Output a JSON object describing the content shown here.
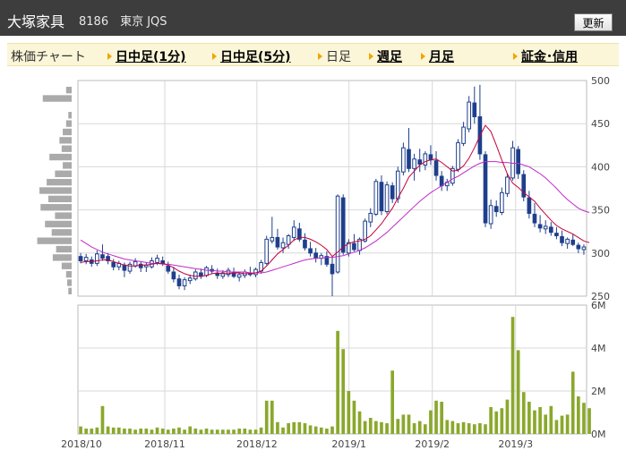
{
  "header": {
    "company": "大塚家具",
    "meta": "8186　東京 JQS",
    "refresh_label": "更新"
  },
  "tabs": [
    {
      "label": "株価チャート",
      "link": false,
      "arrow": false
    },
    {
      "label": "日中足(1分)",
      "link": true,
      "arrow": true
    },
    {
      "label": "日中足(5分)",
      "link": true,
      "arrow": true
    },
    {
      "label": "日足",
      "link": false,
      "arrow": true
    },
    {
      "label": "週足",
      "link": true,
      "arrow": true
    },
    {
      "label": "月足",
      "link": true,
      "arrow": true
    },
    {
      "label": "証金･信用",
      "link": true,
      "arrow": true
    }
  ],
  "chart_data": [
    {
      "type": "candlestick",
      "y_ticks": [
        "500",
        "450",
        "400",
        "350",
        "300",
        "250"
      ],
      "ylim": [
        250,
        500
      ],
      "x_ticks": [
        "2018/10",
        "2018/11",
        "2018/12",
        "2019/1",
        "2019/2",
        "2019/3"
      ],
      "candles": [
        [
          296,
          300,
          288,
          291
        ],
        [
          291,
          299,
          287,
          295
        ],
        [
          292,
          296,
          284,
          288
        ],
        [
          288,
          303,
          285,
          299
        ],
        [
          298,
          310,
          291,
          294
        ],
        [
          296,
          300,
          287,
          291
        ],
        [
          289,
          293,
          280,
          284
        ],
        [
          284,
          291,
          280,
          288
        ],
        [
          286,
          289,
          272,
          280
        ],
        [
          279,
          290,
          276,
          287
        ],
        [
          285,
          294,
          283,
          290
        ],
        [
          287,
          290,
          278,
          283
        ],
        [
          284,
          289,
          278,
          286
        ],
        [
          284,
          295,
          282,
          291
        ],
        [
          289,
          298,
          286,
          294
        ],
        [
          291,
          296,
          285,
          288
        ],
        [
          285,
          290,
          276,
          279
        ],
        [
          278,
          284,
          266,
          270
        ],
        [
          270,
          275,
          258,
          262
        ],
        [
          262,
          272,
          257,
          269
        ],
        [
          268,
          275,
          264,
          271
        ],
        [
          270,
          281,
          268,
          278
        ],
        [
          277,
          282,
          270,
          273
        ],
        [
          274,
          285,
          272,
          283
        ],
        [
          281,
          286,
          276,
          279
        ],
        [
          276,
          282,
          270,
          274
        ],
        [
          273,
          280,
          270,
          277
        ],
        [
          275,
          283,
          272,
          280
        ],
        [
          278,
          283,
          271,
          273
        ],
        [
          272,
          278,
          267,
          275
        ],
        [
          274,
          281,
          271,
          278
        ],
        [
          277,
          284,
          273,
          275
        ],
        [
          275,
          283,
          272,
          281
        ],
        [
          279,
          292,
          276,
          289
        ],
        [
          288,
          320,
          286,
          316
        ],
        [
          314,
          342,
          311,
          318
        ],
        [
          318,
          328,
          304,
          307
        ],
        [
          306,
          318,
          300,
          312
        ],
        [
          310,
          322,
          305,
          320
        ],
        [
          318,
          338,
          314,
          330
        ],
        [
          328,
          335,
          313,
          316
        ],
        [
          315,
          323,
          303,
          306
        ],
        [
          305,
          313,
          296,
          300
        ],
        [
          300,
          306,
          289,
          294
        ],
        [
          294,
          300,
          286,
          297
        ],
        [
          296,
          302,
          284,
          287
        ],
        [
          287,
          295,
          250,
          276
        ],
        [
          278,
          368,
          276,
          366
        ],
        [
          364,
          368,
          298,
          301
        ],
        [
          300,
          316,
          296,
          312
        ],
        [
          311,
          322,
          302,
          304
        ],
        [
          303,
          318,
          298,
          316
        ],
        [
          314,
          340,
          312,
          337
        ],
        [
          336,
          352,
          330,
          346
        ],
        [
          345,
          386,
          343,
          383
        ],
        [
          382,
          390,
          344,
          349
        ],
        [
          348,
          383,
          345,
          379
        ],
        [
          378,
          382,
          358,
          363
        ],
        [
          363,
          400,
          358,
          395
        ],
        [
          394,
          428,
          390,
          422
        ],
        [
          420,
          445,
          394,
          398
        ],
        [
          398,
          415,
          384,
          409
        ],
        [
          408,
          421,
          394,
          403
        ],
        [
          402,
          418,
          396,
          415
        ],
        [
          414,
          425,
          402,
          408
        ],
        [
          407,
          418,
          384,
          390
        ],
        [
          389,
          395,
          372,
          378
        ],
        [
          378,
          386,
          372,
          382
        ],
        [
          381,
          401,
          378,
          398
        ],
        [
          397,
          432,
          394,
          428
        ],
        [
          427,
          452,
          424,
          446
        ],
        [
          444,
          482,
          440,
          475
        ],
        [
          474,
          493,
          450,
          458
        ],
        [
          458,
          495,
          408,
          415
        ],
        [
          414,
          418,
          330,
          335
        ],
        [
          334,
          362,
          328,
          355
        ],
        [
          354,
          361,
          342,
          348
        ],
        [
          347,
          376,
          344,
          370
        ],
        [
          369,
          392,
          365,
          388
        ],
        [
          387,
          430,
          384,
          422
        ],
        [
          420,
          424,
          386,
          392
        ],
        [
          391,
          396,
          360,
          365
        ],
        [
          364,
          372,
          340,
          346
        ],
        [
          345,
          358,
          330,
          335
        ],
        [
          333,
          344,
          324,
          329
        ],
        [
          328,
          338,
          322,
          331
        ],
        [
          330,
          336,
          320,
          324
        ],
        [
          323,
          330,
          316,
          320
        ],
        [
          319,
          326,
          308,
          312
        ],
        [
          311,
          318,
          305,
          316
        ],
        [
          315,
          322,
          308,
          310
        ],
        [
          309,
          312,
          300,
          305
        ],
        [
          304,
          310,
          298,
          307
        ]
      ],
      "ma_short": [
        289,
        290,
        290,
        291,
        292,
        292,
        290,
        288,
        286,
        285,
        285,
        286,
        286,
        287,
        288,
        288,
        286,
        283,
        279,
        276,
        274,
        273,
        273,
        274,
        276,
        277,
        276,
        276,
        277,
        277,
        276,
        276,
        277,
        279,
        285,
        292,
        299,
        304,
        309,
        315,
        318,
        318,
        316,
        313,
        309,
        304,
        296,
        301,
        307,
        311,
        313,
        314,
        316,
        320,
        327,
        334,
        343,
        352,
        364,
        375,
        388,
        395,
        402,
        406,
        408,
        409,
        405,
        400,
        395,
        396,
        401,
        410,
        422,
        436,
        448,
        441,
        425,
        408,
        392,
        381,
        376,
        370,
        365,
        360,
        352,
        345,
        338,
        332,
        328,
        325,
        322,
        318,
        314,
        312
      ],
      "ma_long": [
        315,
        311,
        307,
        304,
        301,
        299,
        297,
        295,
        293,
        292,
        291,
        290,
        289,
        288,
        288,
        287,
        287,
        286,
        285,
        284,
        283,
        282,
        281,
        280,
        280,
        279,
        279,
        278,
        278,
        278,
        278,
        277,
        277,
        277,
        278,
        280,
        282,
        284,
        286,
        288,
        290,
        292,
        293,
        294,
        294,
        295,
        295,
        296,
        297,
        299,
        301,
        303,
        306,
        310,
        314,
        319,
        324,
        330,
        336,
        342,
        348,
        354,
        360,
        365,
        370,
        374,
        378,
        382,
        386,
        389,
        393,
        397,
        401,
        404,
        406,
        406,
        406,
        405,
        405,
        404,
        404,
        402,
        400,
        396,
        392,
        387,
        381,
        375,
        368,
        362,
        357,
        352,
        349,
        347
      ]
    },
    {
      "type": "bar",
      "y_ticks": [
        "6M",
        "4M",
        "2M",
        "0M"
      ],
      "ylim": [
        0,
        6
      ],
      "values": [
        0.35,
        0.25,
        0.25,
        0.3,
        1.3,
        0.35,
        0.3,
        0.3,
        0.25,
        0.25,
        0.2,
        0.25,
        0.25,
        0.2,
        0.3,
        0.25,
        0.2,
        0.25,
        0.3,
        0.2,
        0.35,
        0.25,
        0.2,
        0.25,
        0.2,
        0.2,
        0.2,
        0.2,
        0.2,
        0.25,
        0.25,
        0.2,
        0.2,
        0.3,
        1.55,
        1.55,
        0.55,
        0.3,
        0.5,
        0.55,
        0.55,
        0.5,
        0.4,
        0.35,
        0.3,
        0.25,
        0.35,
        4.8,
        3.95,
        2.0,
        1.55,
        1.05,
        0.6,
        0.75,
        0.6,
        0.55,
        0.5,
        2.95,
        0.7,
        0.9,
        0.9,
        0.5,
        0.6,
        0.45,
        1.1,
        1.55,
        1.5,
        0.65,
        0.6,
        0.5,
        0.55,
        0.5,
        0.45,
        0.5,
        0.45,
        1.25,
        1.05,
        1.2,
        1.6,
        5.45,
        3.9,
        1.95,
        1.5,
        1.1,
        1.25,
        0.9,
        1.3,
        0.65,
        0.85,
        0.9,
        2.9,
        1.75,
        1.45,
        1.2
      ],
      "ma_line": [
        0.3,
        0.3,
        0.35,
        0.5,
        0.6,
        0.5,
        0.45,
        0.4,
        0.35,
        0.3,
        0.3,
        0.3,
        0.28,
        0.27,
        0.27,
        0.27,
        0.26,
        0.26,
        0.27,
        0.27,
        0.27,
        0.27,
        0.26,
        0.25,
        0.24,
        0.23,
        0.22,
        0.22,
        0.22,
        0.23,
        0.23,
        0.23,
        0.24,
        0.3,
        0.5,
        0.7,
        0.8,
        0.8,
        0.8,
        0.85,
        0.85,
        0.75,
        0.6,
        0.5,
        0.45,
        0.4,
        0.8,
        1.5,
        2.0,
        2.2,
        2.1,
        1.8,
        1.5,
        1.3,
        1.1,
        0.9,
        0.8,
        1.1,
        1.1,
        1.0,
        0.9,
        0.85,
        0.8,
        0.75,
        0.8,
        0.9,
        0.95,
        0.95,
        0.9,
        0.85,
        0.8,
        0.75,
        0.7,
        0.6,
        0.65,
        0.75,
        0.85,
        1.1,
        1.8,
        2.5,
        2.7,
        2.5,
        2.0,
        1.6,
        1.4,
        1.2,
        1.1,
        1.05,
        1.2,
        1.4,
        1.5,
        1.4,
        1.3
      ]
    }
  ],
  "volume_profile": [
    0.1,
    0.52,
    0.0,
    0.06,
    0.1,
    0.16,
    0.22,
    0.18,
    0.4,
    0.16,
    0.3,
    0.45,
    0.58,
    0.42,
    0.56,
    0.3,
    0.48,
    0.36,
    0.62,
    0.28,
    0.34,
    0.18,
    0.1,
    0.08,
    0.06
  ],
  "colors": {
    "candle": "#1e3f8c",
    "ma_short": "#c4003b",
    "ma_long": "#c02ac8",
    "volume": "#8aa82c",
    "grid": "#d8d8d8",
    "frame": "#bbbbbb",
    "profile": "#aaaaaa"
  }
}
